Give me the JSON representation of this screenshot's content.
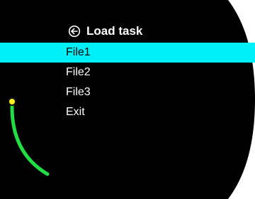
{
  "header": {
    "title": "Load task",
    "icon": "back-arrow-icon"
  },
  "menu": {
    "items": [
      {
        "label": "File1",
        "selected": true
      },
      {
        "label": "File2",
        "selected": false
      },
      {
        "label": "File3",
        "selected": false
      },
      {
        "label": "Exit",
        "selected": false
      }
    ]
  },
  "colors": {
    "background": "#000000",
    "highlight": "#00f0fa",
    "text": "#ffffff",
    "scroll_track": "#22dd44",
    "scroll_thumb": "#ffee22"
  }
}
